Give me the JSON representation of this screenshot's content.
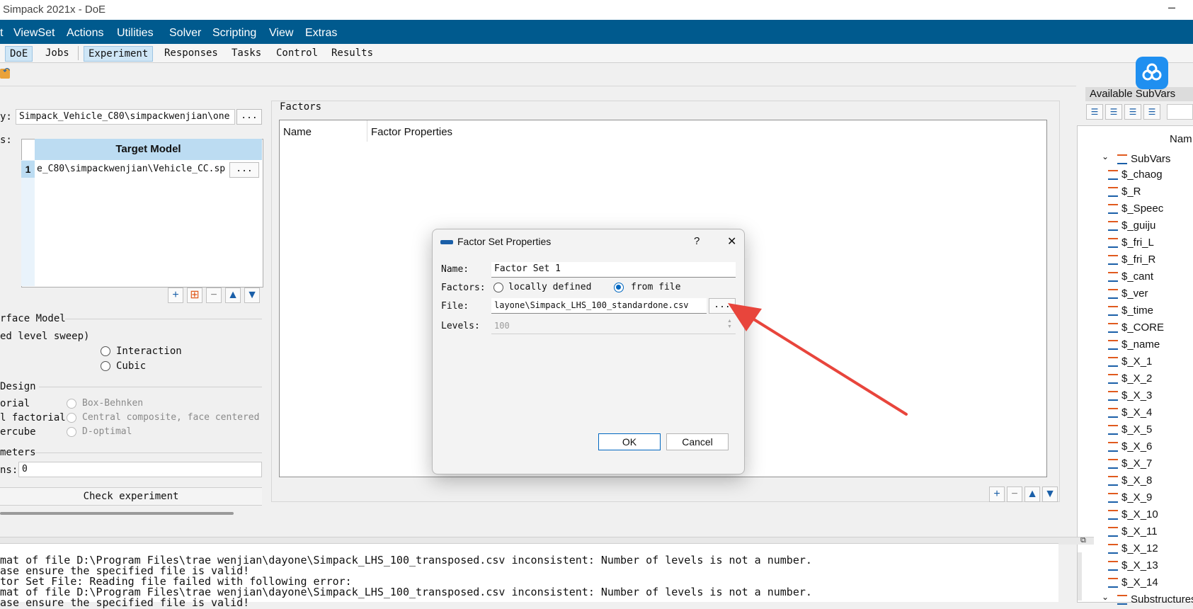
{
  "window": {
    "title": "Simpack 2021x - DoE",
    "minimize": "–"
  },
  "menu": [
    "t",
    "ViewSet",
    "Actions",
    "Utilities",
    "Solver",
    "Scripting",
    "View",
    "Extras"
  ],
  "top_tabs": [
    "DoE",
    "Jobs"
  ],
  "sub_tabs": [
    "Experiment",
    "Responses",
    "Tasks",
    "Control",
    "Results"
  ],
  "left": {
    "dir_label": "y:",
    "dir_value": "Simpack_Vehicle_C80\\simpackwenjian\\one",
    "dots": "...",
    "models_label": "s:",
    "target_header": "Target Model",
    "row_num": "1",
    "row_value": "e_C80\\simpackwenjian\\Vehicle_CC.sp",
    "surface_title": "rface Model",
    "sweep_label": "ed level sweep)",
    "interaction": "Interaction",
    "cubic": "Cubic",
    "design_title": "Design",
    "design_opts_left": [
      "orial",
      "l factorial",
      "ercube"
    ],
    "design_opts_right": [
      "Box-Behnken",
      "Central composite, face centered",
      "D-optimal"
    ],
    "params_title": "meters",
    "runs_label": "ns:",
    "runs_value": "0",
    "check_button": "Check experiment"
  },
  "factors": {
    "title": "Factors",
    "col_name": "Name",
    "col_props": "Factor Properties"
  },
  "dialog": {
    "title": "Factor Set Properties",
    "help": "?",
    "close": "✕",
    "name_label": "Name:",
    "name_value": "Factor Set 1",
    "factors_label": "Factors:",
    "opt_local": "locally defined",
    "opt_file": "from file",
    "file_label": "File:",
    "file_value": "layone\\Simpack_LHS_100_standardone.csv",
    "file_dots": "...",
    "levels_label": "Levels:",
    "levels_value": "100",
    "ok": "OK",
    "cancel": "Cancel"
  },
  "right": {
    "title": "Available SubVars",
    "col_name": "Nam",
    "root": "SubVars",
    "items": [
      "$_chaog",
      "$_R",
      "$_Speec",
      "$_guiju",
      "$_fri_L",
      "$_fri_R",
      "$_cant",
      "$_ver",
      "$_time",
      "$_CORE",
      "$_name",
      "$_X_1",
      "$_X_2",
      "$_X_3",
      "$_X_4",
      "$_X_5",
      "$_X_6",
      "$_X_7",
      "$_X_8",
      "$_X_9",
      "$_X_10",
      "$_X_11",
      "$_X_12",
      "$_X_13",
      "$_X_14"
    ],
    "next_root": "Substructures"
  },
  "log": [
    "mat of file D:\\Program Files\\trae wenjian\\dayone\\Simpack_LHS_100_transposed.csv inconsistent: Number of levels is not a number.",
    "ase ensure the specified file is valid!",
    "tor Set File: Reading file failed with following error:",
    "mat of file D:\\Program Files\\trae wenjian\\dayone\\Simpack_LHS_100_transposed.csv inconsistent: Number of levels is not a number.",
    "ase ensure the specified file is valid!"
  ],
  "colors": {
    "menu_bg": "#005a8e",
    "header_blue": "#bcdcf2",
    "arrow_red": "#e8453c",
    "accent": "#0067c0"
  }
}
